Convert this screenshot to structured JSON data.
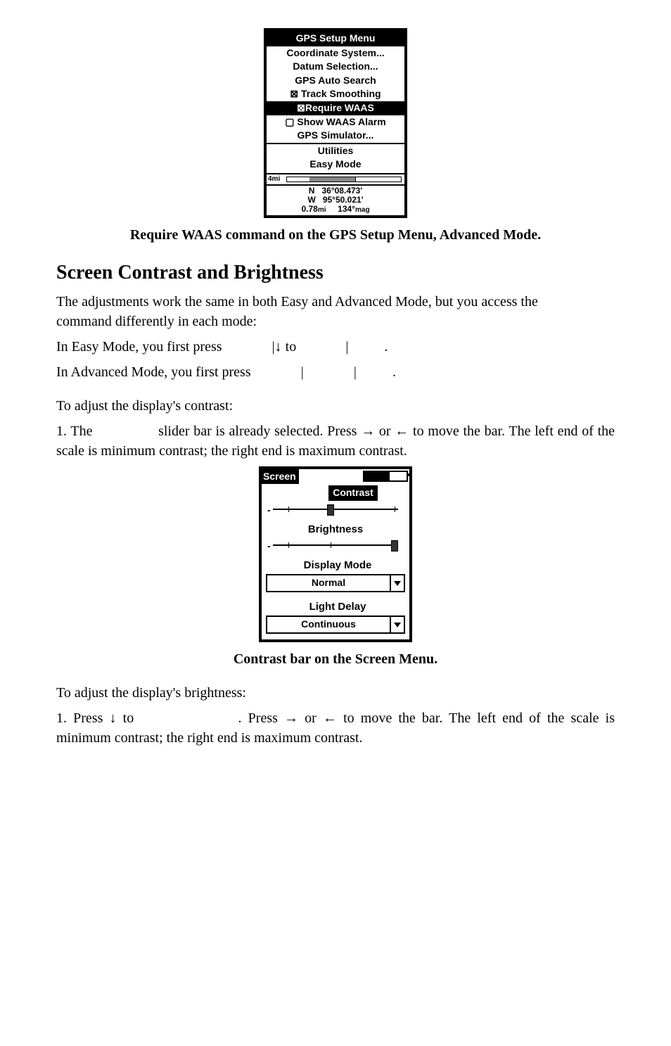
{
  "device1": {
    "title": "GPS Setup Menu",
    "items": {
      "coord": "Coordinate System...",
      "datum": "Datum Selection...",
      "auto": "GPS Auto Search",
      "track": "Track Smoothing",
      "require": "Require WAAS",
      "showalarm": "Show WAAS Alarm",
      "sim": "GPS Simulator..."
    },
    "utilities": "Utilities",
    "easy": "Easy Mode",
    "scale_label": "4mi",
    "coords": {
      "lat_label": "N",
      "lat": "36°08.473'",
      "lon_label": "W",
      "lon": "95°50.021'",
      "dist": "0.78",
      "dist_unit": "mi",
      "bearing": "134°",
      "bearing_unit": "mag"
    }
  },
  "caption1": "Require WAAS command on the GPS Setup Menu, Advanced Mode.",
  "heading": "Screen Contrast and Brightness",
  "para1a": "The adjustments work the same in both Easy and Advanced Mode, but you access the ",
  "para1b": " command differently in each mode:",
  "easy_line_a": "In Easy Mode, you first press ",
  "easy_line_b": "|↓ to ",
  "easy_line_c": "|",
  "easy_line_d": ".",
  "adv_line_a": "In Advanced Mode, you first press ",
  "adv_line_b": "|",
  "adv_line_c": "|",
  "adv_line_d": ".",
  "para2": "To adjust the display's contrast:",
  "para3a": "1. The ",
  "para3b": " slider bar is already selected. Press → or ← to move the bar. The left end of the scale is minimum contrast; the right end is maximum contrast.",
  "device2": {
    "title": "Screen",
    "contrast_label": "Contrast",
    "brightness_label": "Brightness",
    "display_mode_label": "Display Mode",
    "display_mode_value": "Normal",
    "light_delay_label": "Light Delay",
    "light_delay_value": "Continuous"
  },
  "caption2": "Contrast bar on the Screen Menu.",
  "para4": "To adjust the display's brightness:",
  "para5a": "1. Press ↓ to ",
  "para5b": ". Press → or ← to move the bar. The left end of the scale is minimum contrast; the right end is maximum contrast."
}
